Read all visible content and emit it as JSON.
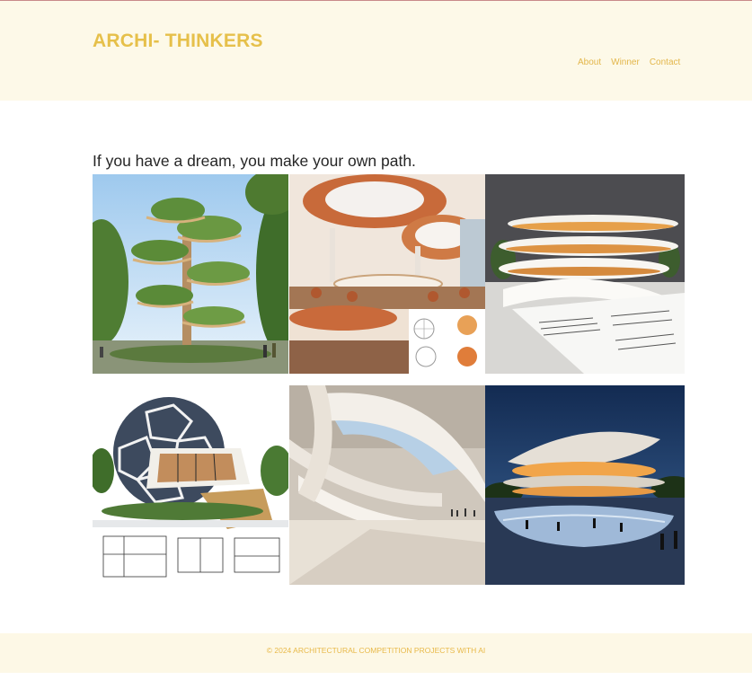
{
  "header": {
    "brand": "ARCHI- THINKERS",
    "nav": [
      "About",
      "Winner",
      "Contact"
    ]
  },
  "main": {
    "tagline": "If you have a dream, you make your own path.",
    "gallery": [
      {
        "subject": "tree-tower"
      },
      {
        "subject": "restaurant-interior"
      },
      {
        "subject": "curved-building-model"
      },
      {
        "subject": "geodesic-dome-house"
      },
      {
        "subject": "curved-atrium"
      },
      {
        "subject": "night-plaza"
      }
    ]
  },
  "footer": {
    "copyright": "© 2024 ARCHITECTURAL COMPETITION PROJECTS WITH AI"
  },
  "colors": {
    "header_bg": "#fdf9e8",
    "brand": "#e6c04a",
    "nav": "#e3b64a",
    "footer_bg": "#fdf8e6",
    "footer_text": "#e8b949",
    "tagline": "#262626"
  }
}
